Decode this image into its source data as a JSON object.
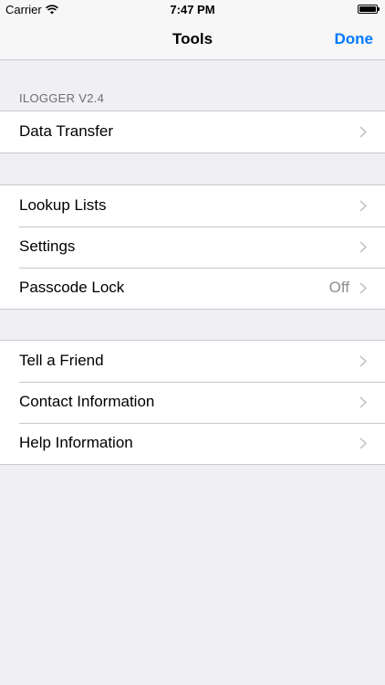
{
  "status_bar": {
    "carrier": "Carrier",
    "time": "7:47 PM"
  },
  "nav": {
    "title": "Tools",
    "done_label": "Done",
    "accent_color": "#007aff"
  },
  "section_header": "ILOGGER V2.4",
  "groups": [
    {
      "rows": [
        {
          "label": "Data Transfer",
          "detail": ""
        }
      ]
    },
    {
      "rows": [
        {
          "label": "Lookup Lists",
          "detail": ""
        },
        {
          "label": "Settings",
          "detail": ""
        },
        {
          "label": "Passcode Lock",
          "detail": "Off"
        }
      ]
    },
    {
      "rows": [
        {
          "label": "Tell a Friend",
          "detail": ""
        },
        {
          "label": "Contact Information",
          "detail": ""
        },
        {
          "label": "Help Information",
          "detail": ""
        }
      ]
    }
  ]
}
